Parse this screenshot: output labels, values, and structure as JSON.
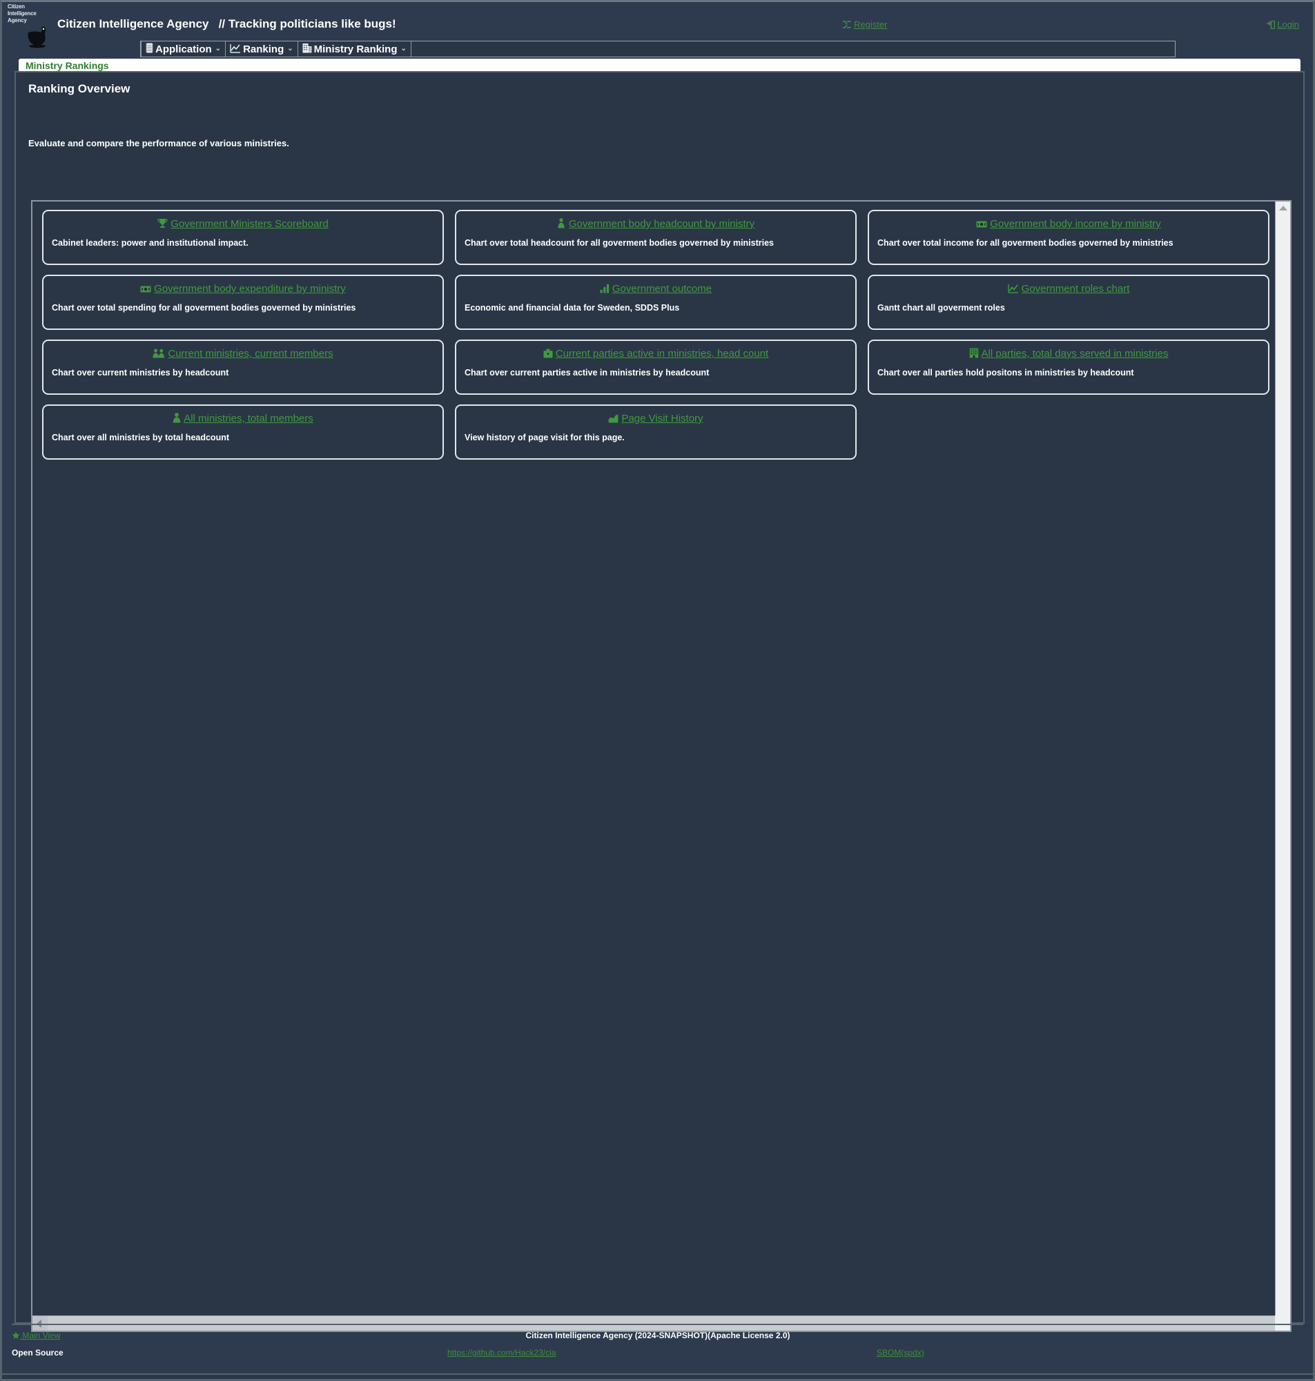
{
  "header": {
    "logo_lines": [
      "Citizen",
      "Intelligence",
      "Agency"
    ],
    "logo_icon": "bug-bird-logo",
    "site_title": "Citizen Intelligence Agency",
    "tagline": "// Tracking politicians like bugs!",
    "register_label": "Register",
    "register_icon": "shuffle-icon",
    "login_label": "Login",
    "login_icon": "sign-in-icon",
    "accent_green": "#3f8c3f",
    "bg_dark": "#2e3b4e"
  },
  "menu": {
    "items": [
      {
        "label": "Application",
        "icon": "document-icon",
        "caret": "⌄"
      },
      {
        "label": "Ranking",
        "icon": "line-chart-icon",
        "caret": "⌄"
      },
      {
        "label": "Ministry Ranking",
        "icon": "building-icon",
        "caret": "⌄"
      }
    ]
  },
  "page": {
    "title": "Ministry Rankings",
    "overview_heading": "Ranking Overview",
    "overview_description": "Evaluate and compare the performance of various ministries."
  },
  "cards": [
    {
      "icon": "trophy-icon",
      "link": "Government Ministers Scoreboard",
      "desc": "Cabinet leaders: power and institutional impact."
    },
    {
      "icon": "person-tie-icon",
      "link": "Government body headcount by ministry",
      "desc": "Chart over total headcount for all goverment bodies governed by ministries"
    },
    {
      "icon": "money-bill-icon",
      "link": "Government body income by ministry",
      "desc": "Chart over total income for all goverment bodies governed by ministries"
    },
    {
      "icon": "money-bill-icon",
      "link": "Government body expenditure by ministry",
      "desc": "Chart over total spending for all goverment bodies governed by ministries"
    },
    {
      "icon": "bar-chart-icon",
      "link": "Government outcome",
      "desc": "Economic and financial data for Sweden, SDDS Plus"
    },
    {
      "icon": "line-chart-icon",
      "link": "Government roles chart",
      "desc": "Gantt chart all goverment roles"
    },
    {
      "icon": "users-icon",
      "link": "Current ministries, current members",
      "desc": "Chart over current ministries by headcount"
    },
    {
      "icon": "briefcase-icon",
      "link": "Current parties active in ministries, head count",
      "desc": "Chart over current parties active in ministries by headcount"
    },
    {
      "icon": "building-icon",
      "link": "All parties, total days served in ministries",
      "desc": "Chart over all parties hold positons in ministries by headcount"
    },
    {
      "icon": "person-icon",
      "link": "All ministries, total members",
      "desc": "Chart over all ministries by total headcount"
    },
    {
      "icon": "area-chart-icon",
      "link": "Page Visit History",
      "desc": "View history of page visit for this page."
    }
  ],
  "footer": {
    "main_view_label": "Main View",
    "main_view_icon": "star-icon",
    "open_source_label": "Open Source",
    "copyright": "Citizen Intelligence Agency (2024-SNAPSHOT)(Apache License 2.0)",
    "github_url": "https://github.com/Hack23/cia",
    "sbom_label": "SBOM(spdx)"
  },
  "scrollbars": {
    "vertical_arrow": "up-arrow",
    "horizontal_arrow": "left-arrow"
  }
}
